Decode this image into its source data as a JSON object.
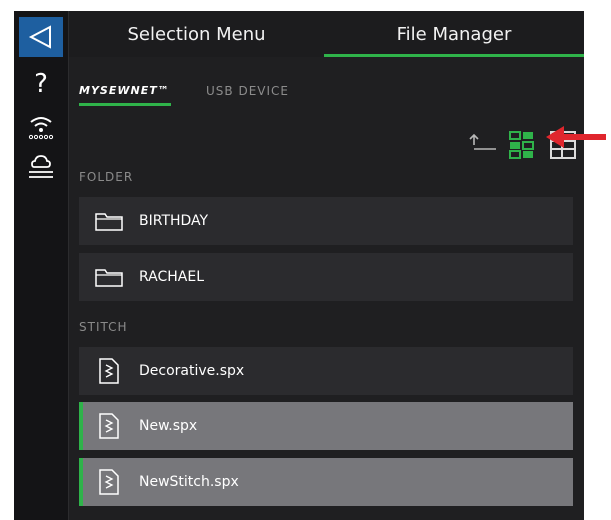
{
  "header": {
    "tabs": [
      {
        "label": "Selection Menu",
        "active": false
      },
      {
        "label": "File Manager",
        "active": true
      }
    ]
  },
  "sources": {
    "tabs": [
      {
        "label": "MYSEWNET™",
        "active": true
      },
      {
        "label": "USB DEVICE",
        "active": false
      }
    ]
  },
  "toolbar": {
    "icons": [
      "folder-up-icon",
      "grid-view-icon",
      "list-view-icon"
    ],
    "selected_view": "grid-view-icon"
  },
  "folders": {
    "section_label": "FOLDER",
    "items": [
      {
        "label": "BIRTHDAY"
      },
      {
        "label": "RACHAEL"
      }
    ]
  },
  "stitches": {
    "section_label": "STITCH",
    "items": [
      {
        "label": "Decorative.spx",
        "selected": false
      },
      {
        "label": "New.spx",
        "selected": true
      },
      {
        "label": "NewStitch.spx",
        "selected": true
      }
    ]
  },
  "colors": {
    "accent": "#2fb34a",
    "back_button": "#1e5fa0",
    "annotation_arrow": "#e0262d"
  }
}
